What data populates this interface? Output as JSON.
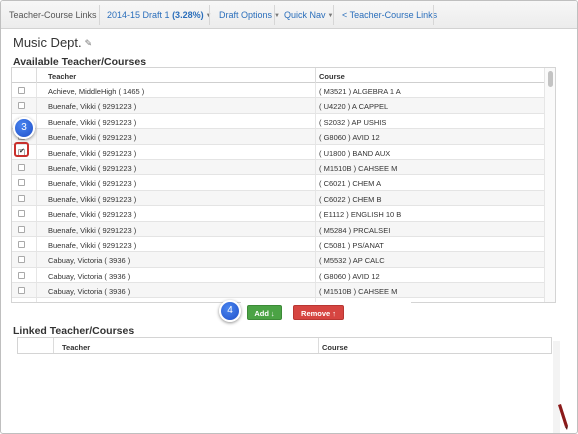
{
  "nav": {
    "brand": "Teacher-Course Links",
    "draft_label": "2014-15 Draft 1",
    "draft_pct": "(3.28%)",
    "draft_options": "Draft Options",
    "quick_nav": "Quick Nav",
    "back_link": "< Teacher-Course Links"
  },
  "page": {
    "dept_title": "Music Dept.",
    "available_heading": "Available Teacher/Courses",
    "linked_heading": "Linked Teacher/Courses"
  },
  "available_table": {
    "headers": {
      "teacher": "Teacher",
      "course": "Course"
    },
    "rows": [
      {
        "teacher": "Achieve, MiddleHigh ( 1465 )",
        "course": "( M3521 ) ALGEBRA 1 A",
        "checked": false
      },
      {
        "teacher": "Buenafe, Vikki ( 9291223 )",
        "course": "( U4220 ) A CAPPEL",
        "checked": false
      },
      {
        "teacher": "Buenafe, Vikki ( 9291223 )",
        "course": "( S2032 ) AP USHIS",
        "checked": false
      },
      {
        "teacher": "Buenafe, Vikki ( 9291223 )",
        "course": "( G8060 ) AVID 12",
        "checked": false
      },
      {
        "teacher": "Buenafe, Vikki ( 9291223 )",
        "course": "( U1800 ) BAND AUX",
        "checked": true
      },
      {
        "teacher": "Buenafe, Vikki ( 9291223 )",
        "course": "( M1510B ) CAHSEE M",
        "checked": false
      },
      {
        "teacher": "Buenafe, Vikki ( 9291223 )",
        "course": "( C6021 ) CHEM A",
        "checked": false
      },
      {
        "teacher": "Buenafe, Vikki ( 9291223 )",
        "course": "( C6022 ) CHEM B",
        "checked": false
      },
      {
        "teacher": "Buenafe, Vikki ( 9291223 )",
        "course": "( E1112 ) ENGLISH 10 B",
        "checked": false
      },
      {
        "teacher": "Buenafe, Vikki ( 9291223 )",
        "course": "( M5284 ) PRCALSEI",
        "checked": false
      },
      {
        "teacher": "Buenafe, Vikki ( 9291223 )",
        "course": "( C5081 ) PS/ANAT",
        "checked": false
      },
      {
        "teacher": "Cabuay, Victoria ( 3936 )",
        "course": "( M5532 ) AP CALC",
        "checked": false
      },
      {
        "teacher": "Cabuay, Victoria ( 3936 )",
        "course": "( G8060 ) AVID 12",
        "checked": false
      },
      {
        "teacher": "Cabuay, Victoria ( 3936 )",
        "course": "( M1510B ) CAHSEE M",
        "checked": false
      },
      {
        "teacher": "Cabuay, Victoria ( 3936 )",
        "course": "( M1510 ) CAHSEE M",
        "checked": false
      }
    ]
  },
  "buttons": {
    "add": "Add",
    "add_arrow": "↓",
    "remove": "Remove",
    "remove_arrow": "↑"
  },
  "linked_table": {
    "headers": {
      "teacher": "Teacher",
      "course": "Course"
    }
  },
  "callouts": {
    "step3": "3",
    "step4": "4"
  },
  "colors": {
    "link": "#2a6ebb",
    "add_button": "#4ba345",
    "remove_button": "#d64541",
    "callout": "#1f4fc9",
    "highlight": "#c9302c"
  }
}
